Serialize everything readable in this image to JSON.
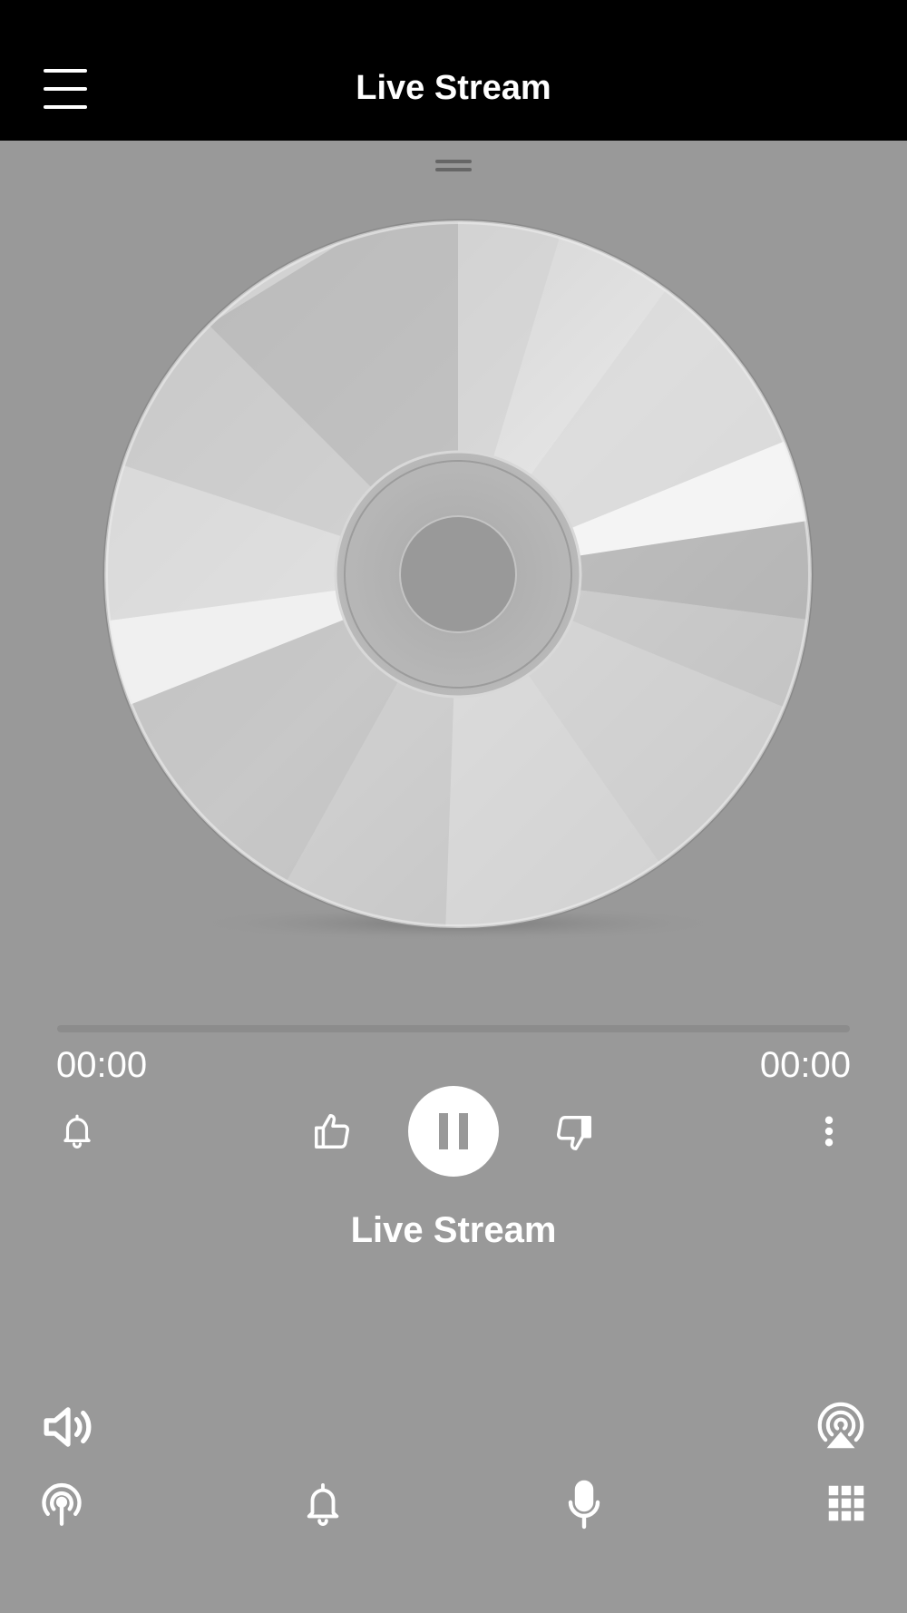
{
  "header": {
    "title": "Live Stream",
    "menu_icon": "hamburger-menu-icon",
    "background": "#000000"
  },
  "player": {
    "artwork_icon": "compact-disc-icon",
    "progress": 0,
    "elapsed": "00:00",
    "duration": "00:00",
    "track_title": "Live Stream",
    "state": "playing"
  },
  "controls": [
    {
      "name": "alarm",
      "icon": "bell-icon"
    },
    {
      "name": "like",
      "icon": "thumbs-up-icon"
    },
    {
      "name": "pause",
      "icon": "pause-icon"
    },
    {
      "name": "dislike",
      "icon": "thumbs-down-icon"
    },
    {
      "name": "more",
      "icon": "more-vertical-icon"
    }
  ],
  "bottom_bar": {
    "top_row": [
      "volume-icon",
      "airplay-icon"
    ],
    "bottom_row": [
      "podcast-icon",
      "bell-icon",
      "microphone-icon",
      "grid-icon"
    ]
  },
  "colors": {
    "background": "#999999",
    "foreground": "#ffffff",
    "header": "#000000"
  }
}
